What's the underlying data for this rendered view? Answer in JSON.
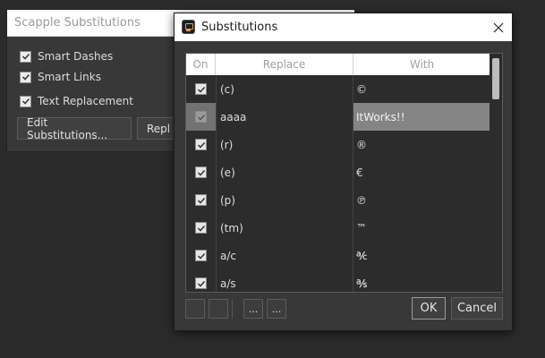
{
  "background_panel": {
    "title": "Scapple Substitutions",
    "checks": [
      {
        "label": "Smart Dashes",
        "checked": true
      },
      {
        "label": "Smart Links",
        "checked": true
      },
      {
        "label": "Text Replacement",
        "checked": true
      }
    ],
    "edit_button": "Edit Substitutions...",
    "replace_button_partial": "Repl"
  },
  "dialog": {
    "title": "Substitutions",
    "columns": {
      "on": "On",
      "replace": "Replace",
      "with": "With"
    },
    "rows": [
      {
        "on": true,
        "replace": "(c)",
        "with": "©"
      },
      {
        "on": true,
        "replace": "aaaa",
        "with": "ItWorks!!",
        "selected": true
      },
      {
        "on": true,
        "replace": "(r)",
        "with": "®"
      },
      {
        "on": true,
        "replace": "(e)",
        "with": "€"
      },
      {
        "on": true,
        "replace": "(p)",
        "with": "℗"
      },
      {
        "on": true,
        "replace": "(tm)",
        "with": "™"
      },
      {
        "on": true,
        "replace": "a/c",
        "with": "℀"
      },
      {
        "on": true,
        "replace": "a/s",
        "with": "℁"
      }
    ],
    "toolbar": {
      "more_1": "...",
      "more_2": "..."
    },
    "ok_label": "OK",
    "cancel_label": "Cancel"
  }
}
